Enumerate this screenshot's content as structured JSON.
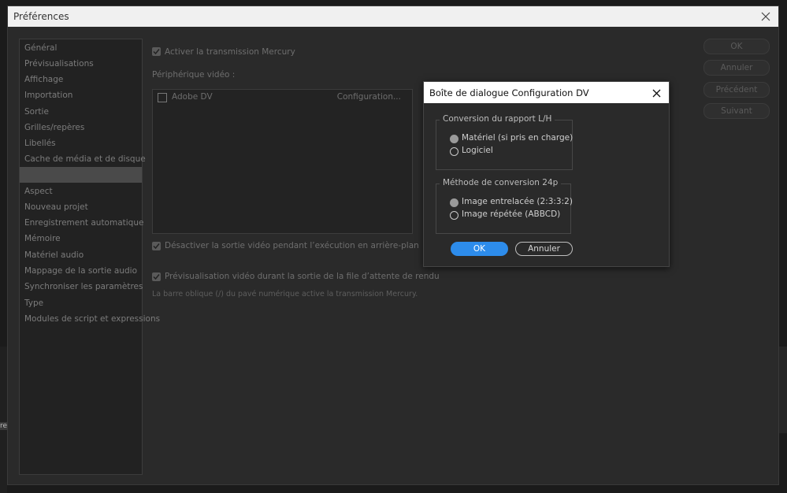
{
  "window": {
    "title": "Préférences"
  },
  "sidebar": {
    "items": [
      {
        "label": "Général"
      },
      {
        "label": "Prévisualisations"
      },
      {
        "label": "Affichage"
      },
      {
        "label": "Importation"
      },
      {
        "label": "Sortie"
      },
      {
        "label": "Grilles/repères"
      },
      {
        "label": "Libellés"
      },
      {
        "label": "Cache de média et de disque"
      },
      {
        "label": ""
      },
      {
        "label": "Aspect"
      },
      {
        "label": "Nouveau projet"
      },
      {
        "label": "Enregistrement automatique"
      },
      {
        "label": "Mémoire"
      },
      {
        "label": "Matériel audio"
      },
      {
        "label": "Mappage de la sortie audio"
      },
      {
        "label": "Synchroniser les paramètres"
      },
      {
        "label": "Type"
      },
      {
        "label": "Modules de script et expressions"
      }
    ]
  },
  "main": {
    "mercury_label": "Activer la transmission Mercury",
    "device_header": "Périphérique vidéo :",
    "device_name": "Adobe DV",
    "device_config": "Configuration...",
    "disable_bg_label": "Désactiver la sortie vidéo pendant l’exécution en arrière-plan",
    "preview_label": "Prévisualisation vidéo durant la sortie de la file d’attente de rendu",
    "hint": "La barre oblique (/) du pavé numérique active la transmission Mercury."
  },
  "side_buttons": {
    "ok": "OK",
    "cancel": "Annuler",
    "prev": "Précédent",
    "next": "Suivant"
  },
  "dv_dialog": {
    "title": "Boîte de dialogue Configuration DV",
    "group1": {
      "legend": "Conversion du rapport L/H",
      "options": [
        "Matériel (si pris en charge)",
        "Logiciel"
      ],
      "selected": "Matériel (si pris en charge)"
    },
    "group2": {
      "legend": "Méthode de conversion 24p",
      "options": [
        "Image entrelacée (2:3:3:2)",
        "Image répétée (ABBCD)"
      ],
      "selected": "Image entrelacée (2:3:3:2)"
    },
    "ok_label": "OK",
    "cancel_label": "Annuler"
  },
  "colors": {
    "accent": "#2d8ceb",
    "panel": "#2a2a2a",
    "selected_row": "#4a4a4a"
  },
  "background": {
    "edge_text": "re"
  }
}
